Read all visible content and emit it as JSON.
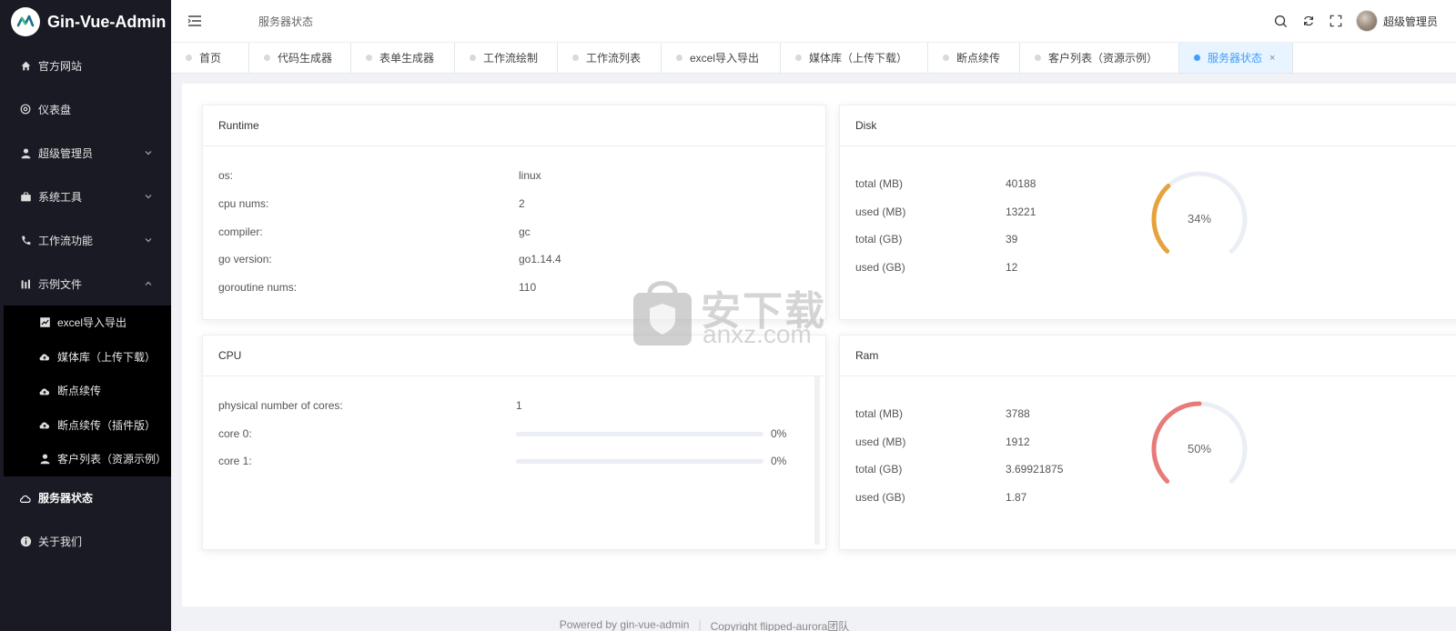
{
  "app": {
    "title": "Gin-Vue-Admin"
  },
  "sidebar": {
    "items": [
      {
        "label": "官方网站",
        "icon": "home-icon"
      },
      {
        "label": "仪表盘",
        "icon": "gear-icon"
      },
      {
        "label": "超级管理员",
        "icon": "user-icon"
      },
      {
        "label": "系统工具",
        "icon": "toolbox-icon"
      },
      {
        "label": "工作流功能",
        "icon": "phone-icon"
      },
      {
        "label": "示例文件",
        "icon": "chart-icon"
      }
    ],
    "sub_items": [
      {
        "label": "excel导入导出",
        "icon": "trend-icon"
      },
      {
        "label": "媒体库（上传下载）",
        "icon": "cloud-upload-icon"
      },
      {
        "label": "断点续传",
        "icon": "cloud-upload-icon"
      },
      {
        "label": "断点续传（插件版）",
        "icon": "cloud-upload-icon"
      },
      {
        "label": "客户列表（资源示例）",
        "icon": "user-icon"
      }
    ],
    "bottom_items": [
      {
        "label": "服务器状态",
        "icon": "cloud-icon"
      },
      {
        "label": "关于我们",
        "icon": "info-icon"
      }
    ]
  },
  "header": {
    "title": "服务器状态",
    "user_name": "超级管理员"
  },
  "tabs": [
    {
      "label": "首页"
    },
    {
      "label": "代码生成器"
    },
    {
      "label": "表单生成器"
    },
    {
      "label": "工作流绘制"
    },
    {
      "label": "工作流列表"
    },
    {
      "label": "excel导入导出"
    },
    {
      "label": "媒体库（上传下载）"
    },
    {
      "label": "断点续传"
    },
    {
      "label": "客户列表（资源示例）"
    },
    {
      "label": "服务器状态",
      "active": true,
      "close": "×"
    }
  ],
  "runtime": {
    "title": "Runtime",
    "rows": [
      {
        "label": "os:",
        "value": "linux"
      },
      {
        "label": "cpu nums:",
        "value": "2"
      },
      {
        "label": "compiler:",
        "value": "gc"
      },
      {
        "label": "go version:",
        "value": "go1.14.4"
      },
      {
        "label": "goroutine nums:",
        "value": "110"
      }
    ]
  },
  "disk": {
    "title": "Disk",
    "rows": [
      {
        "label": "total (MB)",
        "value": "40188"
      },
      {
        "label": "used (MB)",
        "value": "13221"
      },
      {
        "label": "total (GB)",
        "value": "39"
      },
      {
        "label": "used (GB)",
        "value": "12"
      }
    ],
    "percent": 34,
    "percent_label": "34%",
    "color": "#e6a23c"
  },
  "cpu": {
    "title": "CPU",
    "cores_label": "physical number of cores:",
    "cores_value": "1",
    "cores": [
      {
        "label": "core 0:",
        "percent": 0,
        "percent_label": "0%"
      },
      {
        "label": "core 1:",
        "percent": 0,
        "percent_label": "0%"
      }
    ]
  },
  "ram": {
    "title": "Ram",
    "rows": [
      {
        "label": "total (MB)",
        "value": "3788"
      },
      {
        "label": "used (MB)",
        "value": "1912"
      },
      {
        "label": "total (GB)",
        "value": "3.69921875"
      },
      {
        "label": "used (GB)",
        "value": "1.87"
      }
    ],
    "percent": 50,
    "percent_label": "50%",
    "color": "#e97a7a"
  },
  "footer": {
    "powered": "Powered by  gin-vue-admin",
    "copyright": "Copyright  flipped-aurora团队"
  },
  "watermark": {
    "text": "安下载",
    "sub": "anxz.com"
  }
}
